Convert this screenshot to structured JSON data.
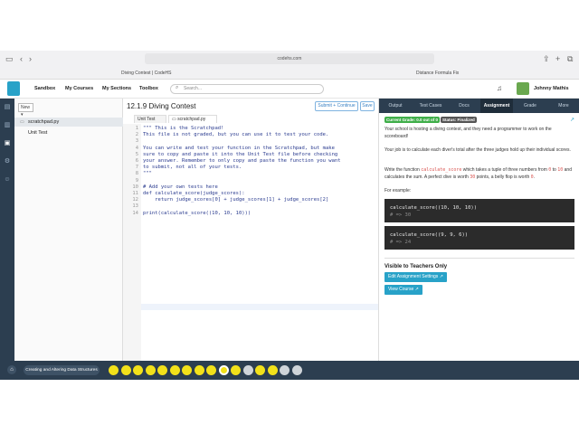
{
  "browser": {
    "url": "codehs.com",
    "tabs": [
      "Diving Contest | CodeHS",
      "Distance Formula Fix"
    ]
  },
  "nav": {
    "items": [
      "Sandbox",
      "My Courses",
      "My Sections",
      "Toolbox"
    ],
    "search_placeholder": "Search...",
    "user_name": "Johnny Mathis"
  },
  "files": {
    "new_label": "New",
    "items": [
      "scratchpad.py",
      "Unit Test"
    ]
  },
  "editor": {
    "title": "12.1.9 Diving Contest",
    "submit_label": "Submit + Continue",
    "save_label": "Save",
    "tabs": [
      "Unit Test",
      "scratchpad.py"
    ],
    "line_numbers": [
      "1",
      "2",
      "3",
      "4",
      "5",
      "6",
      "7",
      "8",
      "9",
      "10",
      "11",
      "12",
      "13",
      "14"
    ],
    "code_lines": [
      "\"\"\" This is the Scratchpad!",
      "This file is not graded, but you can use it to test your code.",
      "",
      "You can write and test your function in the Scratchpad, but make",
      "sure to copy and paste it into the Unit Test file before checking",
      "your answer. Remember to only copy and paste the function you want",
      "to submit, not all of your tests.",
      "\"\"\"",
      "",
      "# Add your own tests here",
      "def calculate_score(judge_scores):",
      "    return judge_scores[0] + judge_scores[1] + judge_scores[2]",
      "",
      "print(calculate_score((10, 10, 10)))"
    ]
  },
  "right_panel": {
    "tabs": [
      "Output",
      "Test Cases",
      "Docs",
      "Assignment",
      "Grade",
      "More"
    ],
    "active_tab": "Assignment",
    "grade_badge": "Current Grade: 0.0 out of 0",
    "status_badge": "Status: Finalized",
    "para1": "Your school is hosting a diving contest, and they need a programmer to work on the scoreboard!",
    "para2": "Your job is to calculate each diver's total after the three judges hold up their individual scores.",
    "para3_a": "Write the function ",
    "para3_fn": "calculate_score",
    "para3_b": " which takes a tuple of three numbers from ",
    "para3_0": "0",
    "para3_to": " to ",
    "para3_10": "10",
    "para3_c": " and calculates the sum. A perfect dive is worth ",
    "para3_30": "30",
    "para3_d": " points, a belly flop is worth ",
    "para3_zero": "0",
    "para3_e": ".",
    "example_label": "For example:",
    "example1_code": "calculate_score((10, 10, 10))",
    "example1_result": "# => 30",
    "example2_code": "calculate_score((9, 9, 6))",
    "example2_result": "# => 24",
    "teachers_title": "Visible to Teachers Only",
    "edit_settings_label": "Edit Assignment Settings",
    "view_course_label": "View Course"
  },
  "bottom": {
    "unit_label": "Creating and Altering Data Structures"
  },
  "colors": {
    "dark_nav": "#2c3e50",
    "accent_teal": "#28a2c8",
    "badge_green": "#3fae49",
    "badge_grey": "#555555",
    "progress_yellow": "#f2e11a"
  }
}
